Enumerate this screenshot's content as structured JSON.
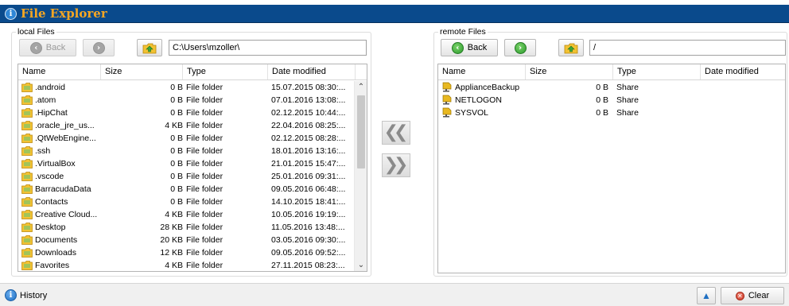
{
  "app": {
    "title": "File Explorer"
  },
  "colors": {
    "title_bar": "#0a4a8c",
    "title_text": "#f5a623",
    "folder_icon": "#f2c232",
    "share_icon": "#e8b820",
    "nav_green": "#2c9a2c",
    "clear_red": "#cc3320"
  },
  "local": {
    "legend": "local Files",
    "back_label": "Back",
    "path": "C:\\Users\\mzoller\\",
    "columns": [
      "Name",
      "Size",
      "Type",
      "Date modified"
    ],
    "rows": [
      {
        "name": ".android",
        "size": "0 B",
        "type": "File folder",
        "date": "15.07.2015 08:30:..."
      },
      {
        "name": ".atom",
        "size": "0 B",
        "type": "File folder",
        "date": "07.01.2016 13:08:..."
      },
      {
        "name": ".HipChat",
        "size": "0 B",
        "type": "File folder",
        "date": "02.12.2015 10:44:..."
      },
      {
        "name": ".oracle_jre_us...",
        "size": "4 KB",
        "type": "File folder",
        "date": "22.04.2016 08:25:..."
      },
      {
        "name": ".QtWebEngine...",
        "size": "0 B",
        "type": "File folder",
        "date": "02.12.2015 08:28:..."
      },
      {
        "name": ".ssh",
        "size": "0 B",
        "type": "File folder",
        "date": "18.01.2016 13:16:..."
      },
      {
        "name": ".VirtualBox",
        "size": "0 B",
        "type": "File folder",
        "date": "21.01.2015 15:47:..."
      },
      {
        "name": ".vscode",
        "size": "0 B",
        "type": "File folder",
        "date": "25.01.2016 09:31:..."
      },
      {
        "name": "BarracudaData",
        "size": "0 B",
        "type": "File folder",
        "date": "09.05.2016 06:48:..."
      },
      {
        "name": "Contacts",
        "size": "0 B",
        "type": "File folder",
        "date": "14.10.2015 18:41:..."
      },
      {
        "name": "Creative Cloud...",
        "size": "4 KB",
        "type": "File folder",
        "date": "10.05.2016 19:19:..."
      },
      {
        "name": "Desktop",
        "size": "28 KB",
        "type": "File folder",
        "date": "11.05.2016 13:48:..."
      },
      {
        "name": "Documents",
        "size": "20 KB",
        "type": "File folder",
        "date": "03.05.2016 09:30:..."
      },
      {
        "name": "Downloads",
        "size": "12 KB",
        "type": "File folder",
        "date": "09.05.2016 09:52:..."
      },
      {
        "name": "Favorites",
        "size": "4 KB",
        "type": "File folder",
        "date": "27.11.2015 08:23:..."
      }
    ]
  },
  "remote": {
    "legend": "remote Files",
    "back_label": "Back",
    "path": "/",
    "columns": [
      "Name",
      "Size",
      "Type",
      "Date modified"
    ],
    "rows": [
      {
        "name": "ApplianceBackup",
        "size": "0 B",
        "type": "Share"
      },
      {
        "name": "NETLOGON",
        "size": "0 B",
        "type": "Share"
      },
      {
        "name": "SYSVOL",
        "size": "0 B",
        "type": "Share"
      }
    ]
  },
  "footer": {
    "history_label": "History",
    "clear_label": "Clear"
  }
}
